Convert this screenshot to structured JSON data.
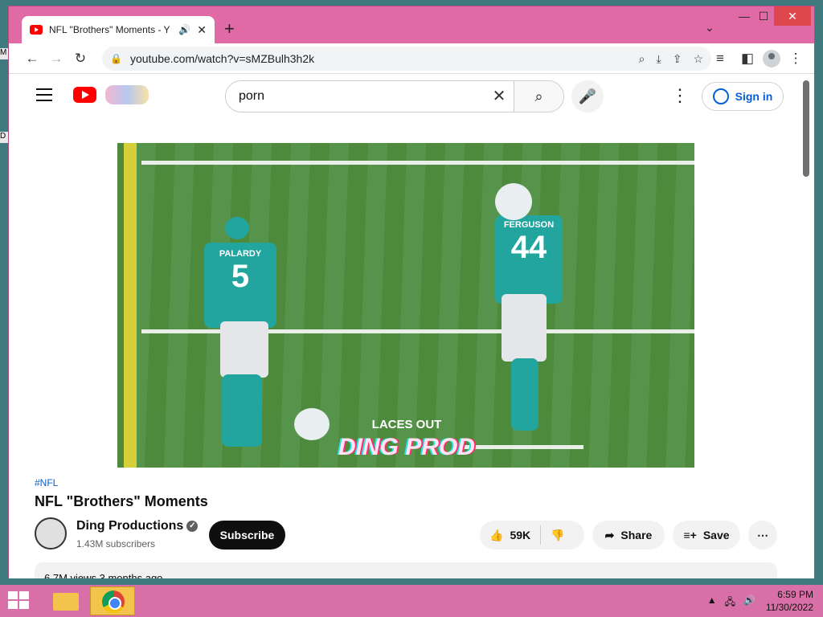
{
  "browser": {
    "tab_title": "NFL \"Brothers\" Moments - Y",
    "tab_audio_icon": "speaker-icon",
    "url": "youtube.com/watch?v=sMZBulh3h2k"
  },
  "youtube": {
    "search_value": "porn",
    "signin_label": "Sign in"
  },
  "video": {
    "overlay_small": "LACES OUT",
    "overlay_big": "DING PROD",
    "jersey_left_name": "PALARDY",
    "jersey_left_number": "5",
    "jersey_right_name": "FERGUSON",
    "jersey_right_number": "44"
  },
  "details": {
    "hashtag": "#NFL",
    "title": "NFL \"Brothers\" Moments",
    "channel": "Ding Productions",
    "subscribers": "1.43M subscribers",
    "subscribe_label": "Subscribe",
    "likes": "59K",
    "share_label": "Share",
    "save_label": "Save",
    "desc_peek": "6.7M views  3 months ago"
  },
  "taskbar": {
    "time": "6:59 PM",
    "date": "11/30/2022"
  },
  "colors": {
    "window_frame": "#e06aa5",
    "taskbar": "#d96fa7",
    "link": "#065fd4"
  }
}
